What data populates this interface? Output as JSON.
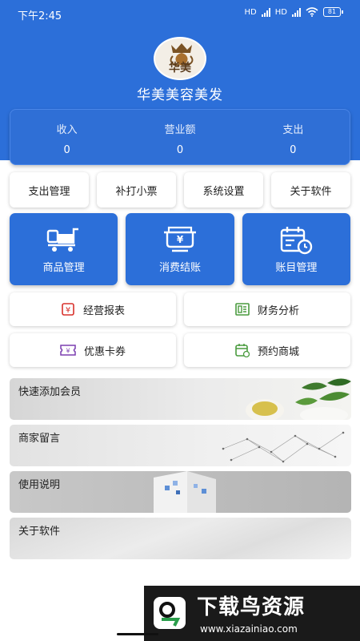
{
  "status_bar": {
    "time": "下午2:45",
    "network_1": "HD",
    "network_2": "HD",
    "battery": "81"
  },
  "app": {
    "title": "华美美容美发",
    "logo_text": "华美"
  },
  "stats": [
    {
      "label": "收入",
      "value": "0"
    },
    {
      "label": "营业额",
      "value": "0"
    },
    {
      "label": "支出",
      "value": "0"
    }
  ],
  "quick_buttons": [
    "支出管理",
    "补打小票",
    "系统设置",
    "关于软件"
  ],
  "main_buttons": [
    "商品管理",
    "消费结账",
    "账目管理"
  ],
  "feature_buttons": [
    "经营报表",
    "财务分析",
    "优惠卡券",
    "预约商城"
  ],
  "banners": [
    "快速添加会员",
    "商家留言",
    "使用说明",
    "关于软件"
  ],
  "watermark": {
    "title": "下载鸟资源",
    "url": "www.xiazainiao.com"
  },
  "colors": {
    "primary": "#2c6fd9",
    "icon_red": "#d8312b",
    "icon_green": "#4a9b3f",
    "icon_purple": "#7b3fb0"
  }
}
